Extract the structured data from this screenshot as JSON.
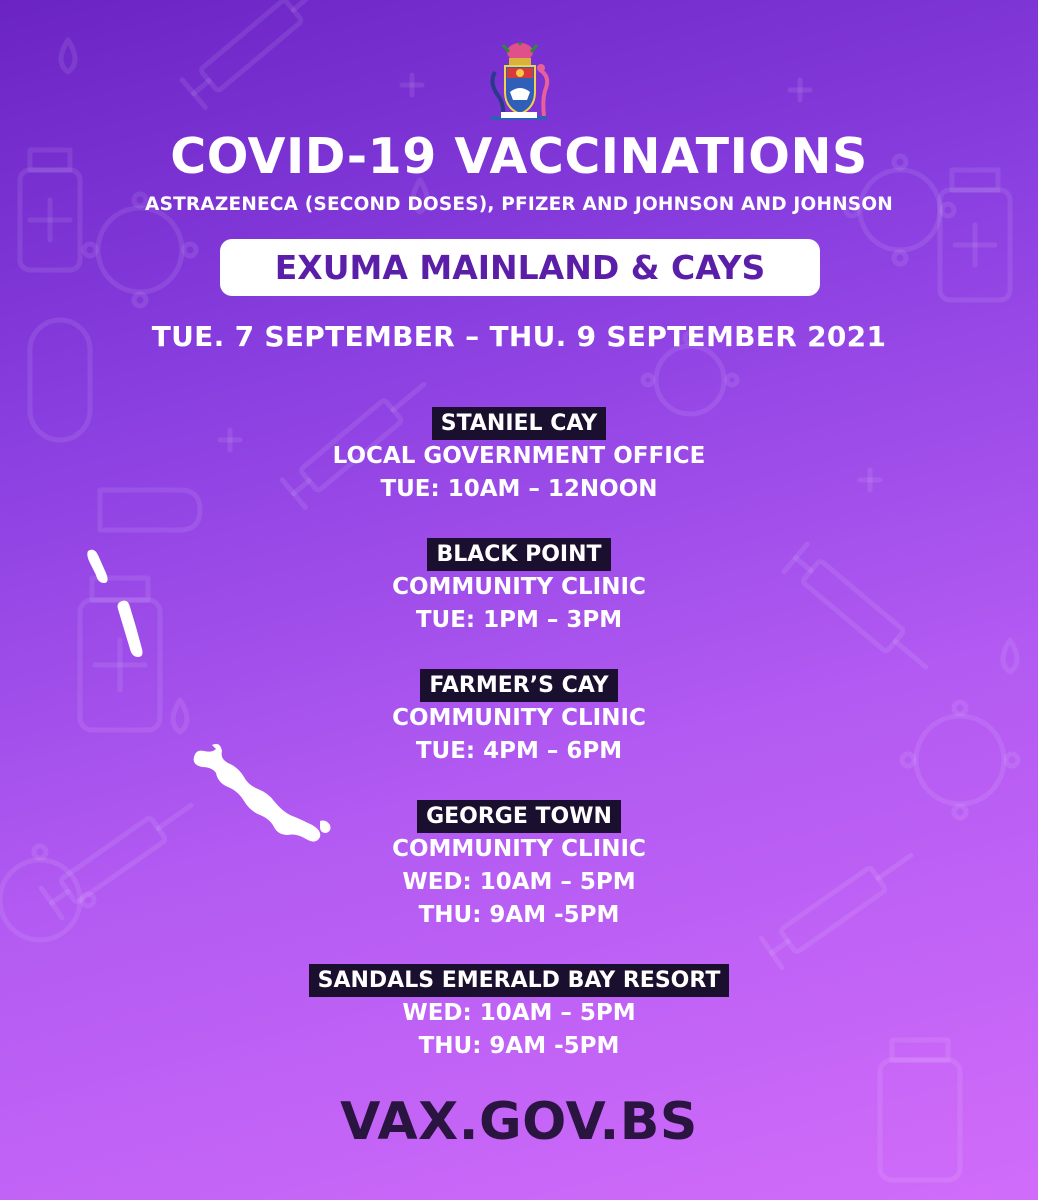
{
  "title": "COVID-19 VACCINATIONS",
  "subtitle": "ASTRAZENECA (SECOND DOSES), PFIZER AND JOHNSON AND JOHNSON",
  "region": "EXUMA MAINLAND & CAYS",
  "dates": "TUE. 7 SEPTEMBER – THU. 9 SEPTEMBER 2021",
  "locations": [
    {
      "name": "STANIEL CAY",
      "lines": [
        "LOCAL GOVERNMENT OFFICE",
        "TUE: 10AM – 12NOON"
      ]
    },
    {
      "name": "BLACK POINT",
      "lines": [
        "COMMUNITY CLINIC",
        "TUE: 1PM – 3PM"
      ]
    },
    {
      "name": "FARMER’S CAY",
      "lines": [
        "COMMUNITY CLINIC",
        "TUE: 4PM – 6PM"
      ]
    },
    {
      "name": "GEORGE TOWN",
      "lines": [
        "COMMUNITY CLINIC",
        "WED: 10AM – 5PM",
        "THU: 9AM -5PM"
      ]
    },
    {
      "name": "SANDALS EMERALD BAY RESORT",
      "lines": [
        "WED: 10AM – 5PM",
        "THU: 9AM -5PM"
      ]
    }
  ],
  "website": "VAX.GOV.BS",
  "colors": {
    "background_top": "#6b24c4",
    "background_bottom": "#d16cfa",
    "pill_text": "#5a1ea8",
    "label_background": "#1a0f2e",
    "website_text": "#2a1540"
  },
  "icons": [
    "bahamas-coat-of-arms",
    "exuma-islands-map",
    "syringe-icon",
    "vaccine-vial-icon",
    "virus-icon",
    "droplet-icon",
    "plus-icon"
  ]
}
